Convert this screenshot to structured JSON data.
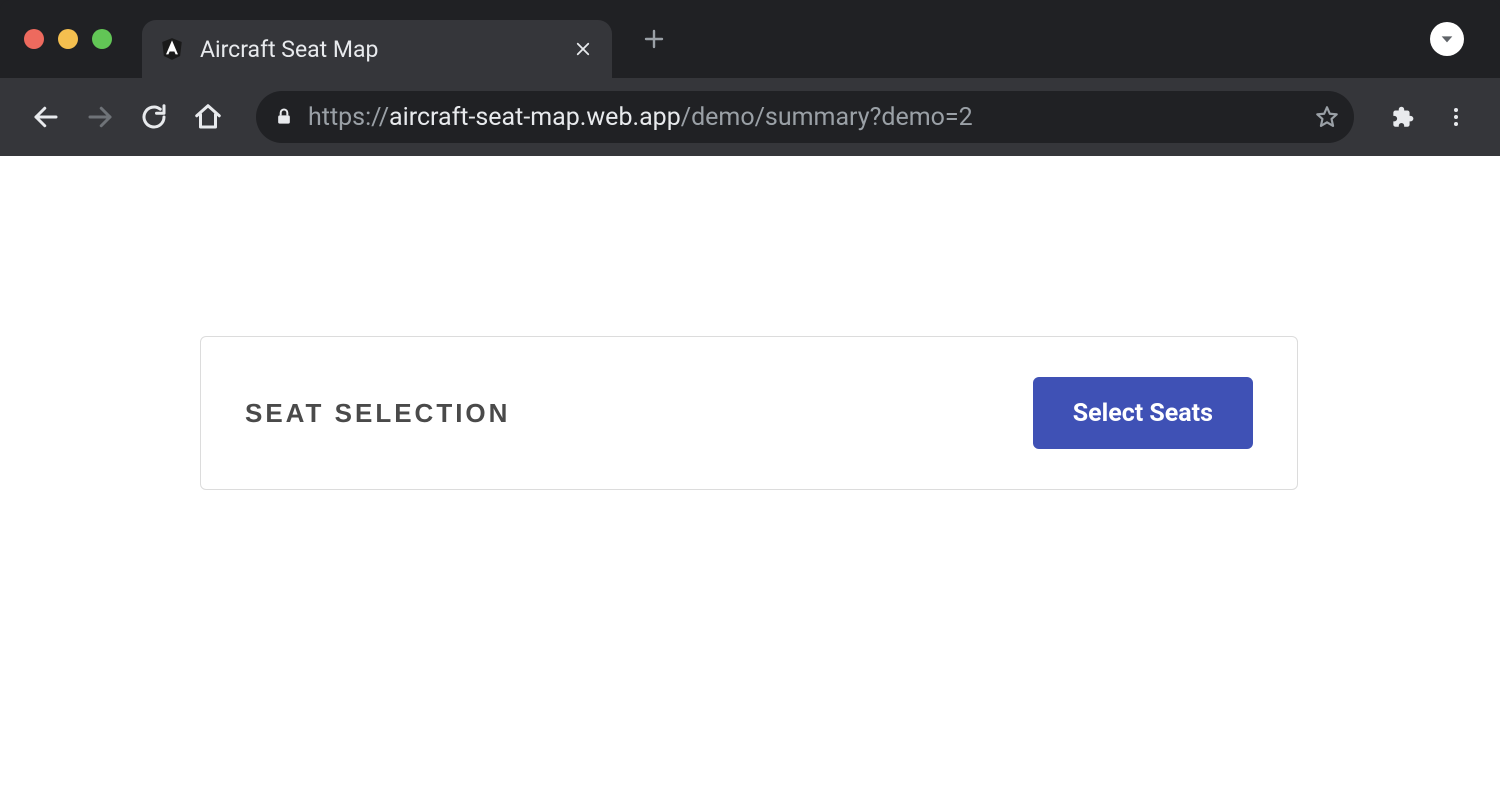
{
  "browser": {
    "tab": {
      "title": "Aircraft Seat Map"
    },
    "url": {
      "scheme": "https://",
      "host": "aircraft-seat-map.web.app",
      "path": "/demo/summary?demo=2"
    }
  },
  "page": {
    "card": {
      "heading": "SEAT SELECTION",
      "button_label": "Select Seats"
    }
  }
}
